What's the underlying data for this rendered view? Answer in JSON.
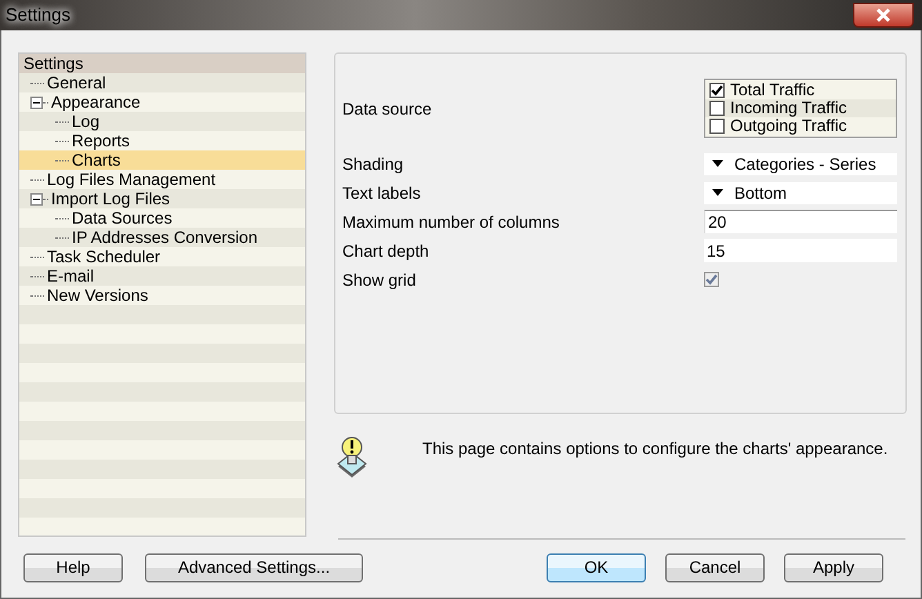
{
  "window": {
    "title": "Settings"
  },
  "tree": {
    "root": "Settings",
    "items": [
      {
        "label": "General",
        "selected": false
      },
      {
        "label": "Appearance",
        "selected": false,
        "expanded": true,
        "children": [
          {
            "label": "Log",
            "selected": false
          },
          {
            "label": "Reports",
            "selected": false
          },
          {
            "label": "Charts",
            "selected": true
          }
        ]
      },
      {
        "label": "Log Files Management",
        "selected": false
      },
      {
        "label": "Import Log Files",
        "selected": false,
        "expanded": true,
        "children": [
          {
            "label": "Data Sources",
            "selected": false
          },
          {
            "label": "IP Addresses Conversion",
            "selected": false
          }
        ]
      },
      {
        "label": "Task Scheduler",
        "selected": false
      },
      {
        "label": "E-mail",
        "selected": false
      },
      {
        "label": "New Versions",
        "selected": false
      }
    ]
  },
  "options": [
    {
      "kind": "checklist",
      "label": "Data source",
      "items": [
        {
          "label": "Total Traffic",
          "checked": true
        },
        {
          "label": "Incoming Traffic",
          "checked": false
        },
        {
          "label": "Outgoing Traffic",
          "checked": false
        }
      ]
    },
    {
      "kind": "dropdown",
      "label": "Shading",
      "value": "Categories - Series"
    },
    {
      "kind": "dropdown",
      "label": "Text labels",
      "value": "Bottom"
    },
    {
      "kind": "input",
      "label": "Maximum number of columns",
      "value": "20"
    },
    {
      "kind": "input",
      "label": "Chart depth",
      "value": "15"
    },
    {
      "kind": "checkbox",
      "label": "Show grid",
      "checked": true,
      "disabled": true
    }
  ],
  "info": "This page contains options to configure the charts' appearance.",
  "buttons_left": [
    {
      "label": "Help",
      "default": false
    },
    {
      "label": "Advanced Settings...",
      "default": false
    }
  ],
  "buttons_right": [
    {
      "label": "OK",
      "default": true
    },
    {
      "label": "Cancel",
      "default": false
    },
    {
      "label": "Apply",
      "default": false
    }
  ]
}
